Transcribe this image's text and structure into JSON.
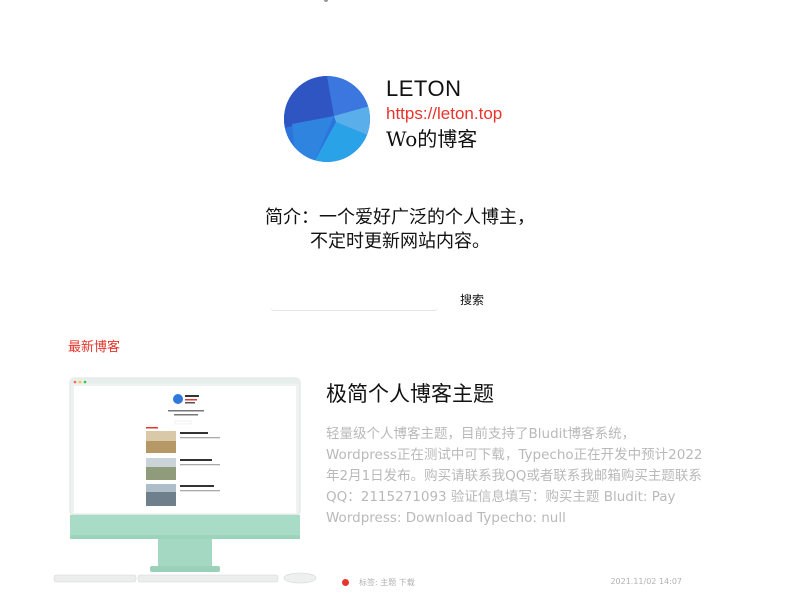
{
  "header": {
    "site_name": "LETON",
    "site_url": "https://leton.top",
    "subtitle": "Wo的博客",
    "logo_icon": "blue-polygon-logo-icon"
  },
  "intro": {
    "line1": "简介：一个爱好广泛的个人博主，",
    "line2": "不定时更新网站内容。"
  },
  "search": {
    "placeholder": "",
    "value": "",
    "button_label": "搜索"
  },
  "section": {
    "title": "最新博客"
  },
  "posts": [
    {
      "title": "极简个人博客主题",
      "excerpt": "轻量级个人博客主题，目前支持了Bludit博客系统，Wordpress正在测试中可下载，Typecho正在开发中预计2022年2月1日发布。购买请联系我QQ或者联系我邮箱购买主题联系QQ：2115271093 验证信息填写：购买主题 Bludit: Pay Wordpress: Download Typecho: null",
      "tags": "标签: 主题 下载",
      "date": "2021.11/02 14:07",
      "image_icon": "imac-screenshot-image"
    }
  ],
  "colors": {
    "accent": "#e8342c",
    "text": "#111111",
    "muted": "#b9b9b9",
    "logo_blues": [
      "#2f5bc8",
      "#3a7fe0",
      "#2f9be6",
      "#5aa9ea",
      "#2a6fd6"
    ],
    "imac_green": "#a8dcc6"
  }
}
